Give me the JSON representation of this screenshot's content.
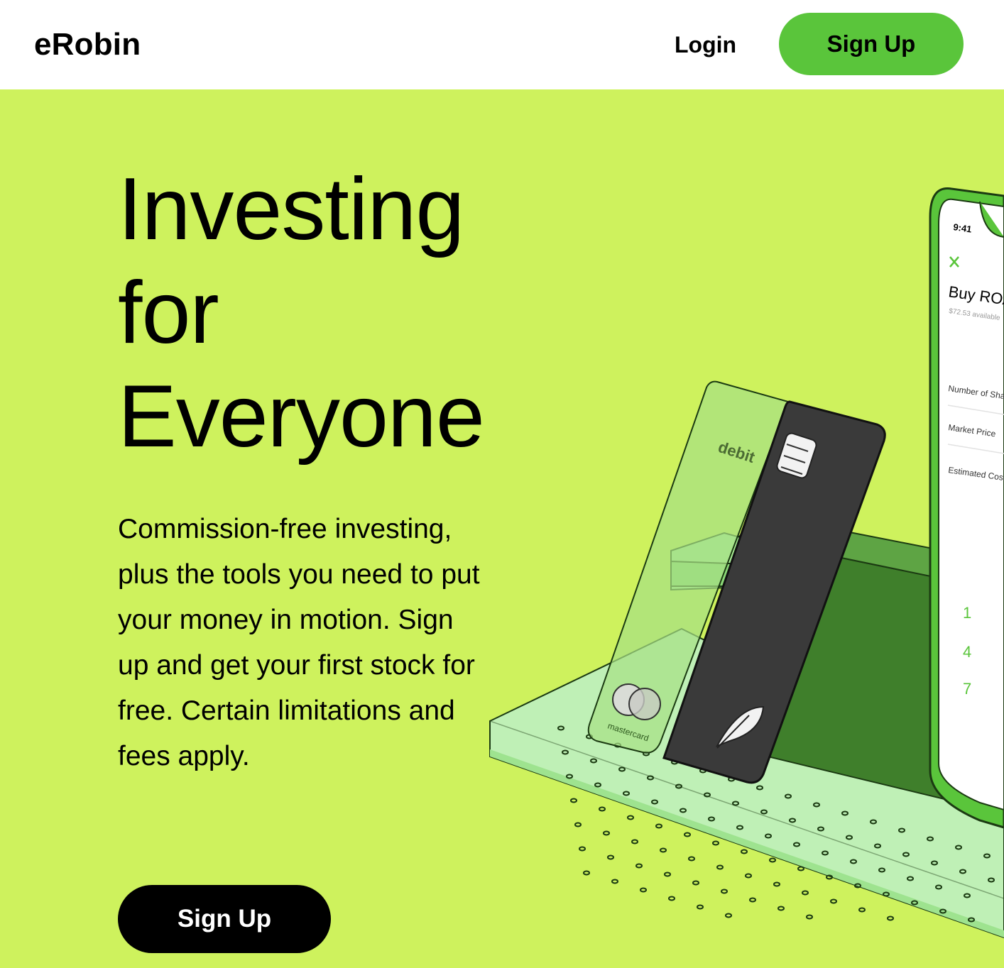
{
  "header": {
    "logo": "eRobin",
    "login_label": "Login",
    "signup_label": "Sign Up"
  },
  "hero": {
    "headline_lines": [
      "Investing",
      "for",
      "Everyone"
    ],
    "description": "Commission-free investing, plus the tools you need to put your money in motion. Sign up and get your first stock for free. Certain limitations and fees apply.",
    "signup_label": "Sign Up"
  },
  "illustration": {
    "card": {
      "debit_label": "debit",
      "network_label": "mastercard"
    },
    "phone": {
      "time": "9:41",
      "title": "Buy ROAR",
      "available": "$72.53 available",
      "rows": [
        "Number of Shares",
        "Market Price",
        "Estimated Cost"
      ],
      "keypad": [
        "1",
        "4",
        "7"
      ]
    }
  },
  "colors": {
    "brand_green": "#5ac53b",
    "hero_background": "#cef25d",
    "button_dark": "#000000"
  }
}
